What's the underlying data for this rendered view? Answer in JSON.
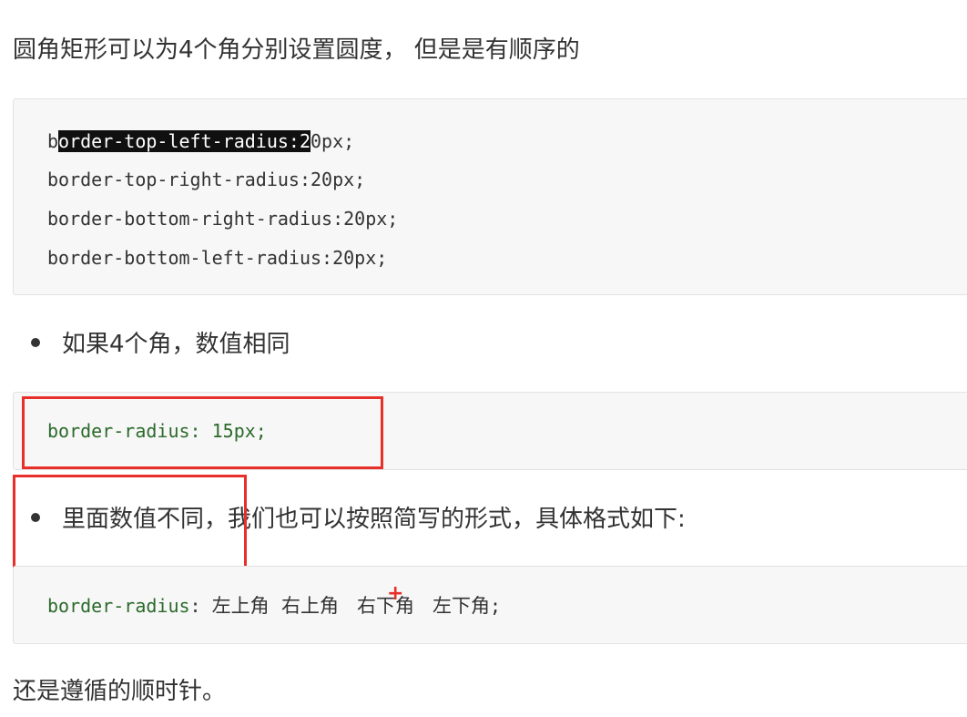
{
  "intro_text": "圆角矩形可以为4个角分别设置圆度， 但是是有顺序的",
  "code_block_1": {
    "line1_pre": "b",
    "line1_highlight": "order-top-left-radius:2",
    "line1_post": "0px;",
    "line2": "border-top-right-radius:20px;",
    "line3": "border-bottom-right-radius:20px;",
    "line4": "border-bottom-left-radius:20px;"
  },
  "bullet_1": "如果4个角，数值相同",
  "code_block_2": {
    "prop": "border-radius",
    "rest": ": 15px;"
  },
  "bullet_2": {
    "boxed": "里面数值不同，",
    "rest": "我们也可以按照简写的形式，具体格式如下:"
  },
  "code_block_3": {
    "prop": "border-radius",
    "colon": ": ",
    "corners": "左上角  右上角   右下角   左下角",
    "end": ";"
  },
  "outro_text": "还是遵循的顺时针。",
  "colors": {
    "annotation_red": "#e8302a",
    "code_green": "#2b6a2b",
    "code_bg": "#f7f7f7"
  }
}
